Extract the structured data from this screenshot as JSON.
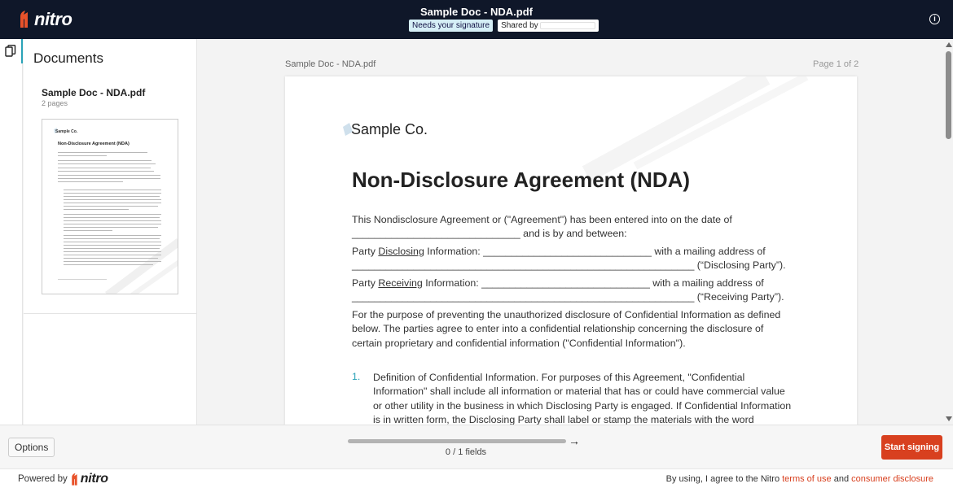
{
  "header": {
    "brand": "nitro",
    "document_title": "Sample Doc - NDA.pdf",
    "badge_status": "Needs your signature",
    "badge_shared": "Shared by",
    "info_icon": "info-icon"
  },
  "sidebar": {
    "rail_icon": "documents-icon",
    "heading": "Documents",
    "documents": [
      {
        "name": "Sample Doc - NDA.pdf",
        "pages": "2 pages",
        "thumb_logo": "Sample Co.",
        "thumb_title": "Non-Disclosure Agreement (NDA)"
      }
    ]
  },
  "viewer": {
    "file_label": "Sample Doc - NDA.pdf",
    "page_indicator": "Page 1 of 2",
    "page": {
      "company": "Sample Co.",
      "title": "Non-Disclosure Agreement (NDA)",
      "intro_line1": "This Nondisclosure Agreement or (\"Agreement\") has been entered into on the date of",
      "intro_line2_blank": "______________________________",
      "intro_line2_rest": " and is by and between:",
      "party_disclosing_prefix": "Party ",
      "party_disclosing_word": "Disclosing",
      "party_disclosing_suffix": " Information: ______________________________ with a mailing address of",
      "party_disclosing_line2": "_____________________________________________________________ (“Disclosing Party”).",
      "party_receiving_prefix": "Party ",
      "party_receiving_word": "Receiving",
      "party_receiving_suffix": " Information: ______________________________ with a mailing address of",
      "party_receiving_line2": "_____________________________________________________________ (“Receiving Party”).",
      "purpose_paragraph": "For the purpose of preventing the unauthorized disclosure of Confidential Information as defined below. The parties agree to enter into a confidential relationship concerning the disclosure of certain proprietary and confidential information (\"Confidential Information\").",
      "item1_number": "1.",
      "item1_text": "Definition of Confidential Information. For purposes of this Agreement, \"Confidential Information\" shall include all information or material that has or could have commercial value or other utility in the business in which Disclosing Party is engaged. If Confidential Information is in written form, the Disclosing Party shall label or stamp the materials with the word \"Confidential\""
    }
  },
  "actionbar": {
    "options_label": "Options",
    "fields_progress": 0,
    "fields_count": "0 / 1 fields",
    "next_icon": "arrow-right-icon",
    "start_label": "Start signing"
  },
  "footer": {
    "powered_by": "Powered by",
    "powered_brand": "nitro",
    "terms_prefix": "By using, I agree to the Nitro ",
    "terms_link": "terms of use",
    "terms_and": " and ",
    "consumer_link": "consumer disclosure"
  },
  "colors": {
    "topbar": "#0f1729",
    "accent": "#2ba3b8",
    "brand": "#d8401f"
  }
}
